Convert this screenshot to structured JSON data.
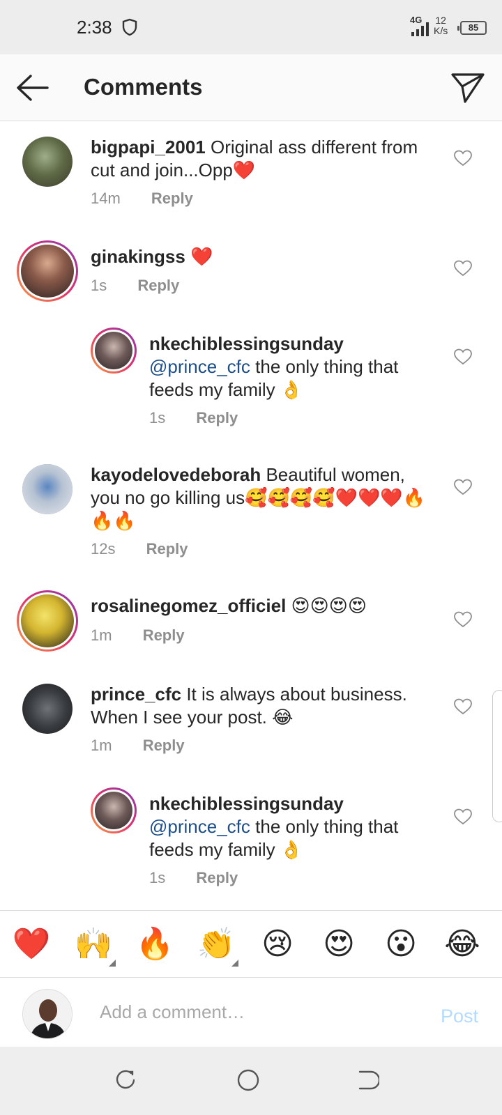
{
  "status_bar": {
    "time": "2:38",
    "network": "4G",
    "speed_value": "12",
    "speed_unit": "K/s",
    "battery": "85"
  },
  "header": {
    "title": "Comments"
  },
  "comments": [
    {
      "username": "bigpapi_2001",
      "text": "Original ass different from cut and join...Opp❤️",
      "time": "14m",
      "reply": "Reply"
    },
    {
      "username": "ginakingss",
      "text": "❤️",
      "time": "1s",
      "reply": "Reply"
    },
    {
      "username": "nkechiblessingsunday",
      "mention": "@prince_cfc",
      "text": "the only thing that feeds my family 👌",
      "time": "1s",
      "reply": "Reply"
    },
    {
      "username": "kayodelovedeborah",
      "text": "Beautiful women, you no go killing us🥰🥰🥰🥰❤️❤️❤️🔥🔥🔥",
      "time": "12s",
      "reply": "Reply"
    },
    {
      "username": "rosalinegomez_officiel",
      "text": "😍😍😍😍",
      "time": "1m",
      "reply": "Reply"
    },
    {
      "username": "prince_cfc",
      "text": "It is always about business. When I see your post. 😂",
      "time": "1m",
      "reply": "Reply"
    },
    {
      "username": "nkechiblessingsunday",
      "mention": "@prince_cfc",
      "text": "the only thing that feeds my family 👌",
      "time": "1s",
      "reply": "Reply"
    }
  ],
  "emoji_bar": [
    "❤️",
    "🙌",
    "🔥",
    "👏",
    "😢",
    "😍",
    "😮",
    "😂"
  ],
  "add_comment": {
    "placeholder": "Add a comment…",
    "post_label": "Post"
  }
}
